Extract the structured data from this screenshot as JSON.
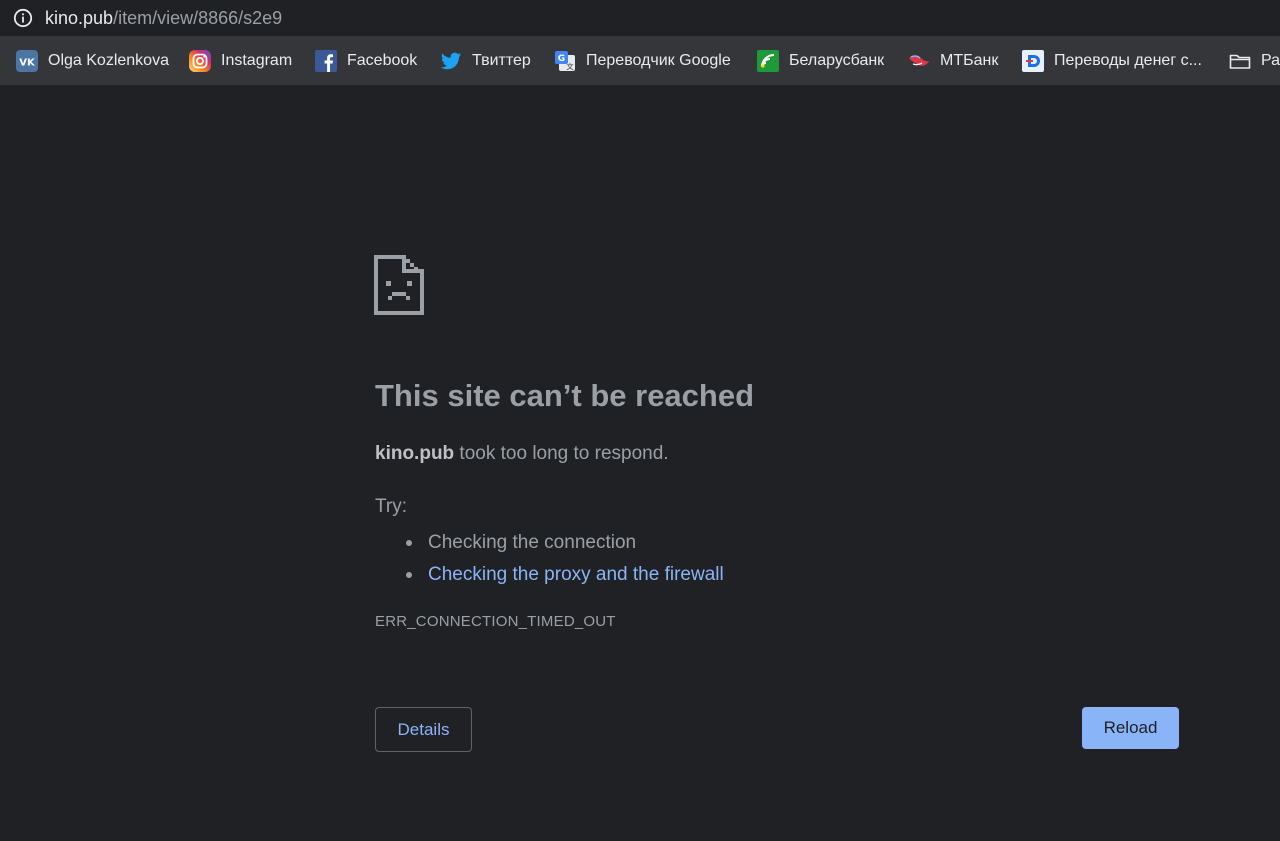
{
  "address_bar": {
    "host": "kino.pub",
    "path": "/item/view/8866/s2e9",
    "icon": "info-icon"
  },
  "bookmarks": [
    {
      "label": "Olga Kozlenkova",
      "icon": "vk-icon",
      "color": "#4c75a3"
    },
    {
      "label": "Instagram",
      "icon": "instagram-icon",
      "color": "#d6249f"
    },
    {
      "label": "Facebook",
      "icon": "facebook-icon",
      "color": "#3b5998"
    },
    {
      "label": "Твиттер",
      "icon": "twitter-icon",
      "color": "#1da1f2"
    },
    {
      "label": "Переводчик Google",
      "icon": "google-translate-icon",
      "color": "#4285f4"
    },
    {
      "label": "Беларусбанк",
      "icon": "belarusbank-icon",
      "color": "#1f9a3a"
    },
    {
      "label": "МТБанк",
      "icon": "mtbank-icon",
      "color": "#e2364d"
    },
    {
      "label": "Переводы денег с...",
      "icon": "money-transfer-icon",
      "color": "#1a73e8"
    },
    {
      "label": "Ра",
      "icon": "folder-icon",
      "color": "#e8eaed"
    }
  ],
  "error": {
    "icon": "sad-page-icon",
    "title": "This site can’t be reached",
    "host": "kino.pub",
    "message": " took too long to respond.",
    "try_label": "Try:",
    "suggestions": [
      {
        "text": "Checking the connection",
        "link": false
      },
      {
        "text": "Checking the proxy and the firewall",
        "link": true
      }
    ],
    "code": "ERR_CONNECTION_TIMED_OUT"
  },
  "buttons": {
    "details": "Details",
    "reload": "Reload"
  },
  "colors": {
    "background": "#202124",
    "bookmarks_bar": "#35363a",
    "text_secondary": "#9aa0a6",
    "link": "#8ab4f8",
    "reload_button": "#8ab4f8"
  }
}
